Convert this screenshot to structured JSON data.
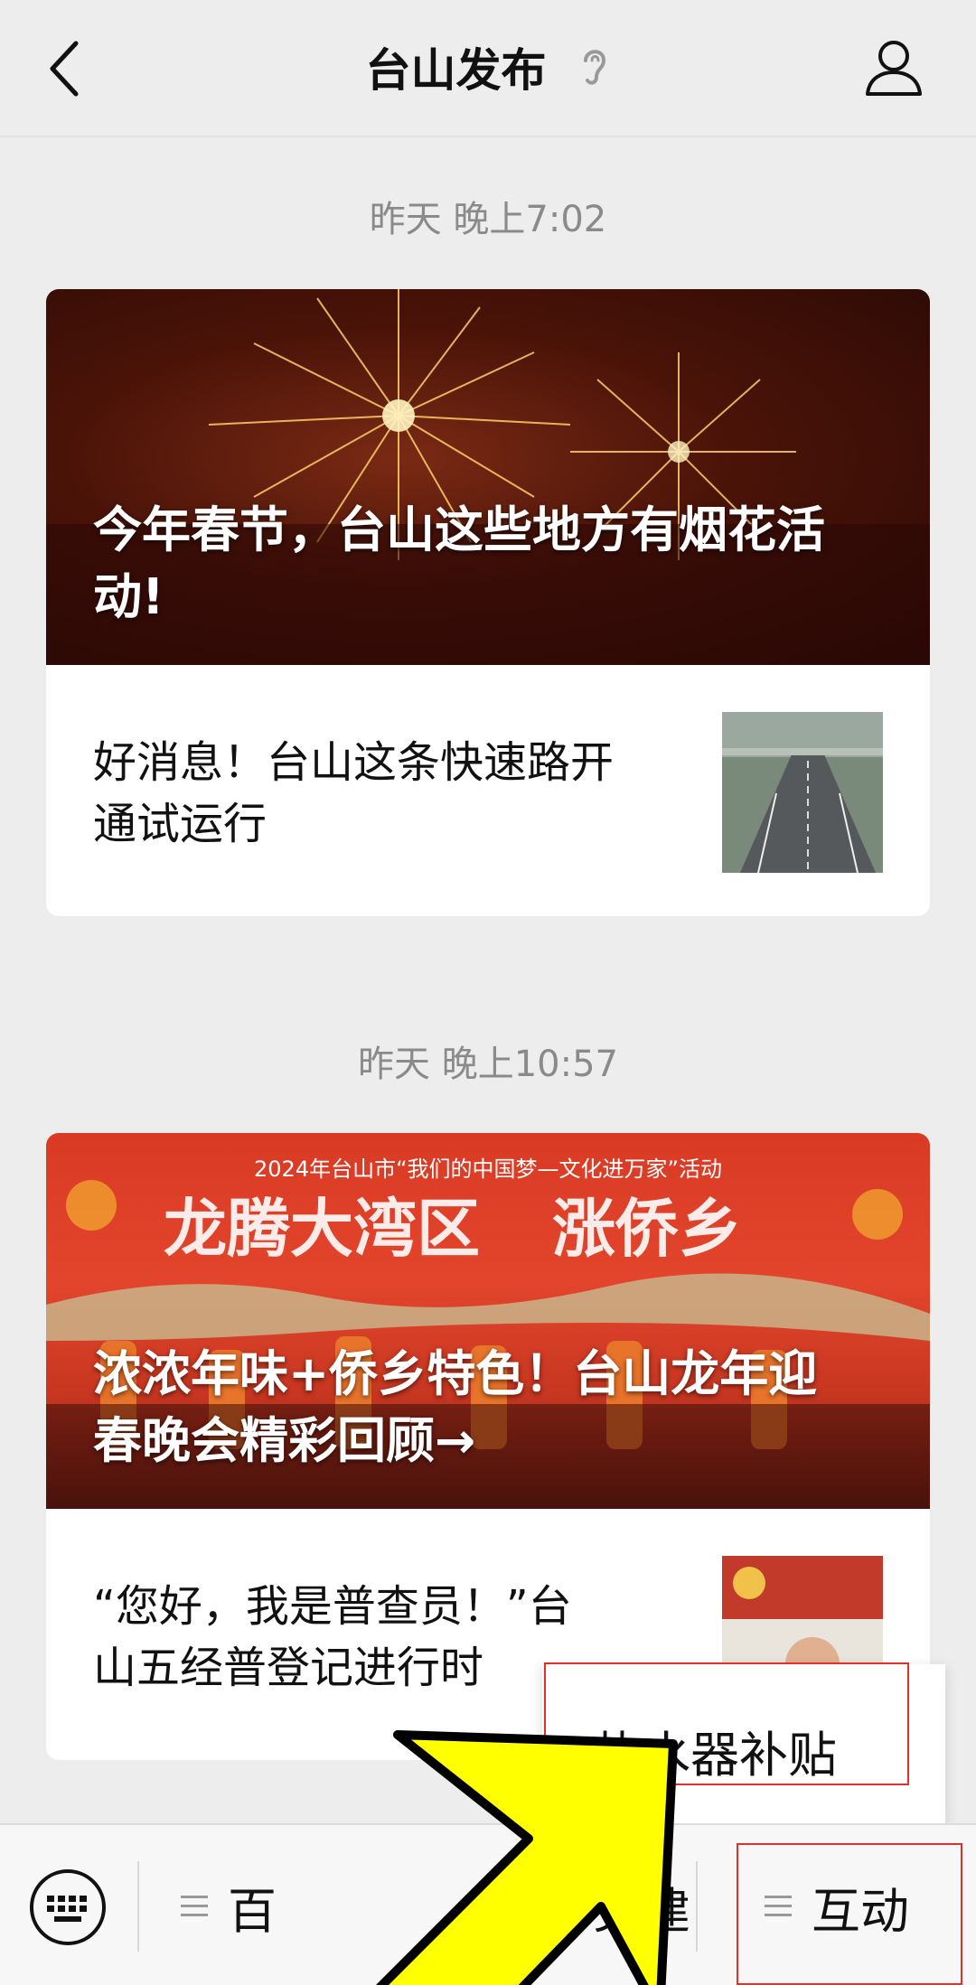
{
  "header": {
    "title": "台山发布",
    "back_icon": "chevron-left-icon",
    "ear_icon": "ear-icon",
    "profile_icon": "person-icon"
  },
  "messages": [
    {
      "timestamp": "昨天 晚上7:02",
      "lead_title": "今年春节，台山这些地方有烟花活动!",
      "lead_title_line1": "今年春节，台山这些地方有烟花活",
      "lead_title_line2": "动!",
      "sub_title_line1": "好消息！台山这条快速路开",
      "sub_title_line2": "通试运行"
    },
    {
      "timestamp": "昨天 晚上10:57",
      "banner_text_top": "2024年台山市“我们的中国梦—文化进万家”活动",
      "lead_title_line1": "浓浓年味+侨乡特色！台山龙年迎",
      "lead_title_line2": "春晚会精彩回顾→",
      "sub_title_line1": "“您好，我是普查员！”台",
      "sub_title_line2": "山五经普登记进行时"
    }
  ],
  "bottom_menu": {
    "keyboard_icon": "keyboard-icon",
    "item1_label": "百",
    "item2_label": "党建",
    "item3_label": "互动",
    "popup_label": "热水器补贴"
  },
  "colors": {
    "highlight": "#e0302a",
    "arrow": "#ffff00"
  }
}
